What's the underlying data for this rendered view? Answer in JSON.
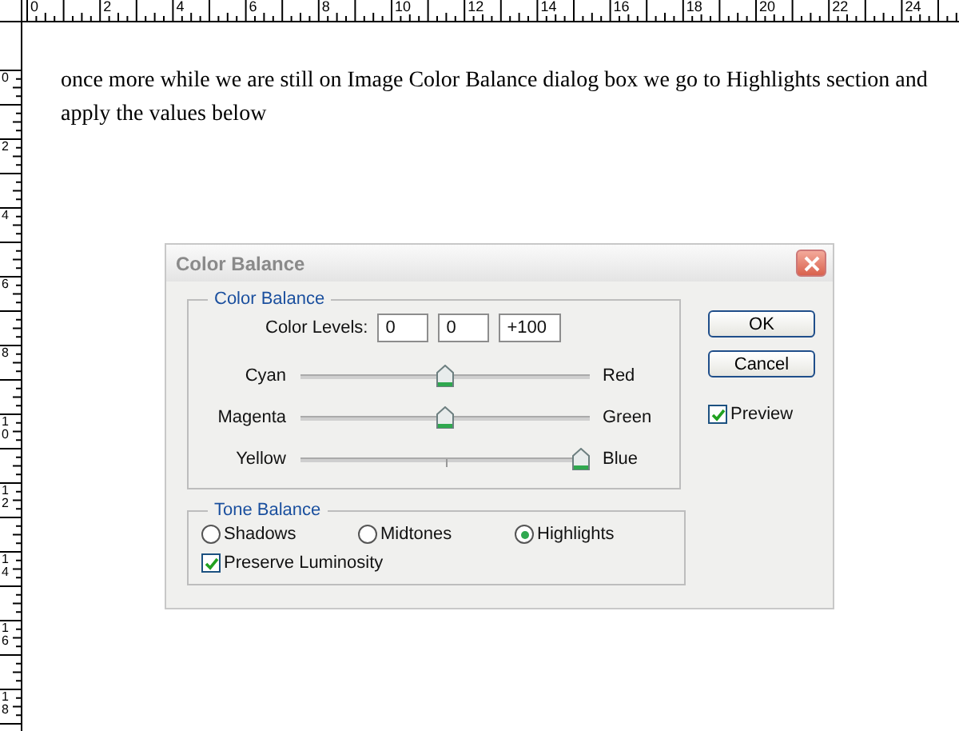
{
  "rulers": {
    "horizontal": [
      "0",
      "2",
      "4",
      "6",
      "8",
      "10",
      "12",
      "14",
      "16",
      "18",
      "20",
      "22",
      "24"
    ],
    "vertical": [
      "0",
      "2",
      "4",
      "6",
      "8",
      "10",
      "12",
      "14",
      "16",
      "18"
    ]
  },
  "document": {
    "text": "once more while we are still on Image Color Balance dialog box we go to Highlights section and apply the values below"
  },
  "dialog": {
    "title": "Color Balance",
    "color_balance": {
      "legend": "Color Balance",
      "levels_label": "Color Levels:",
      "levels": [
        "0",
        "0",
        "+100"
      ],
      "sliders": [
        {
          "left": "Cyan",
          "right": "Red",
          "level": 0.5
        },
        {
          "left": "Magenta",
          "right": "Green",
          "level": 0.5
        },
        {
          "left": "Yellow",
          "right": "Blue",
          "level": 1
        }
      ]
    },
    "tone_balance": {
      "legend": "Tone Balance",
      "options": [
        {
          "label": "Shadows",
          "selected": false
        },
        {
          "label": "Midtones",
          "selected": false
        },
        {
          "label": "Highlights",
          "selected": true
        }
      ],
      "preserve_luminosity": {
        "label": "Preserve Luminosity",
        "checked": true
      }
    },
    "buttons": [
      "OK",
      "Cancel"
    ],
    "preview": {
      "label": "Preview",
      "checked": true
    }
  }
}
